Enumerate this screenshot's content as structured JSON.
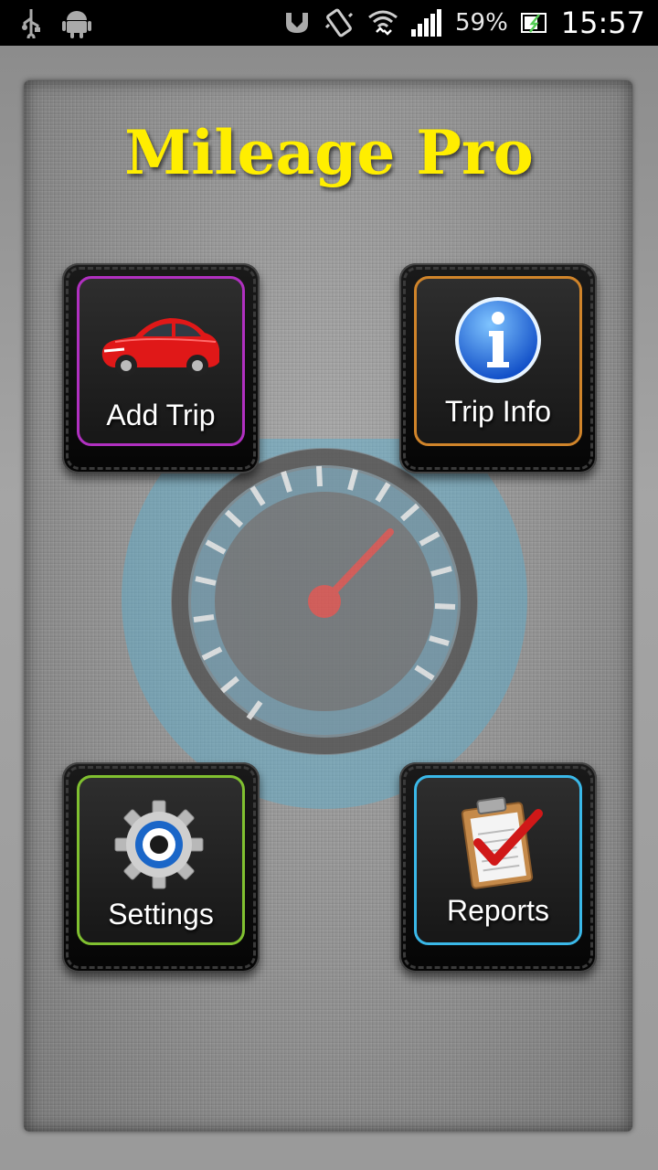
{
  "status_bar": {
    "battery_percent": "59%",
    "clock": "15:57",
    "icons": [
      "usb-icon",
      "android-icon",
      "nfc-icon",
      "vibrate-icon",
      "wifi-icon",
      "signal-icon",
      "battery-icon"
    ]
  },
  "app": {
    "title": "Mileage Pro",
    "title_color": "#ffee00"
  },
  "tiles": {
    "add_trip": {
      "label": "Add Trip",
      "icon": "car-icon",
      "accent": "#b030c0"
    },
    "trip_info": {
      "label": "Trip Info",
      "icon": "info-icon",
      "accent": "#d0842a"
    },
    "settings": {
      "label": "Settings",
      "icon": "gear-icon",
      "accent": "#80c030"
    },
    "reports": {
      "label": "Reports",
      "icon": "clipboard-check-icon",
      "accent": "#3ab8e8"
    }
  }
}
